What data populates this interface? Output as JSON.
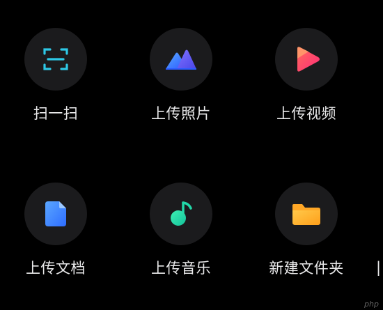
{
  "actions": [
    {
      "id": "scan",
      "label": "扫一扫",
      "icon": "scan-icon",
      "color": "#2ec8e6"
    },
    {
      "id": "upload-photo",
      "label": "上传照片",
      "icon": "mountain-photo-icon",
      "color": "#3b7bff"
    },
    {
      "id": "upload-video",
      "label": "上传视频",
      "icon": "play-video-icon",
      "color": "#ff3d6e"
    },
    {
      "id": "upload-document",
      "label": "上传文档",
      "icon": "document-icon",
      "color": "#3d8bff"
    },
    {
      "id": "upload-music",
      "label": "上传音乐",
      "icon": "music-note-icon",
      "color": "#22d8a8"
    },
    {
      "id": "new-folder",
      "label": "新建文件夹",
      "icon": "folder-icon",
      "color": "#ffb52e"
    }
  ],
  "watermark": "php"
}
